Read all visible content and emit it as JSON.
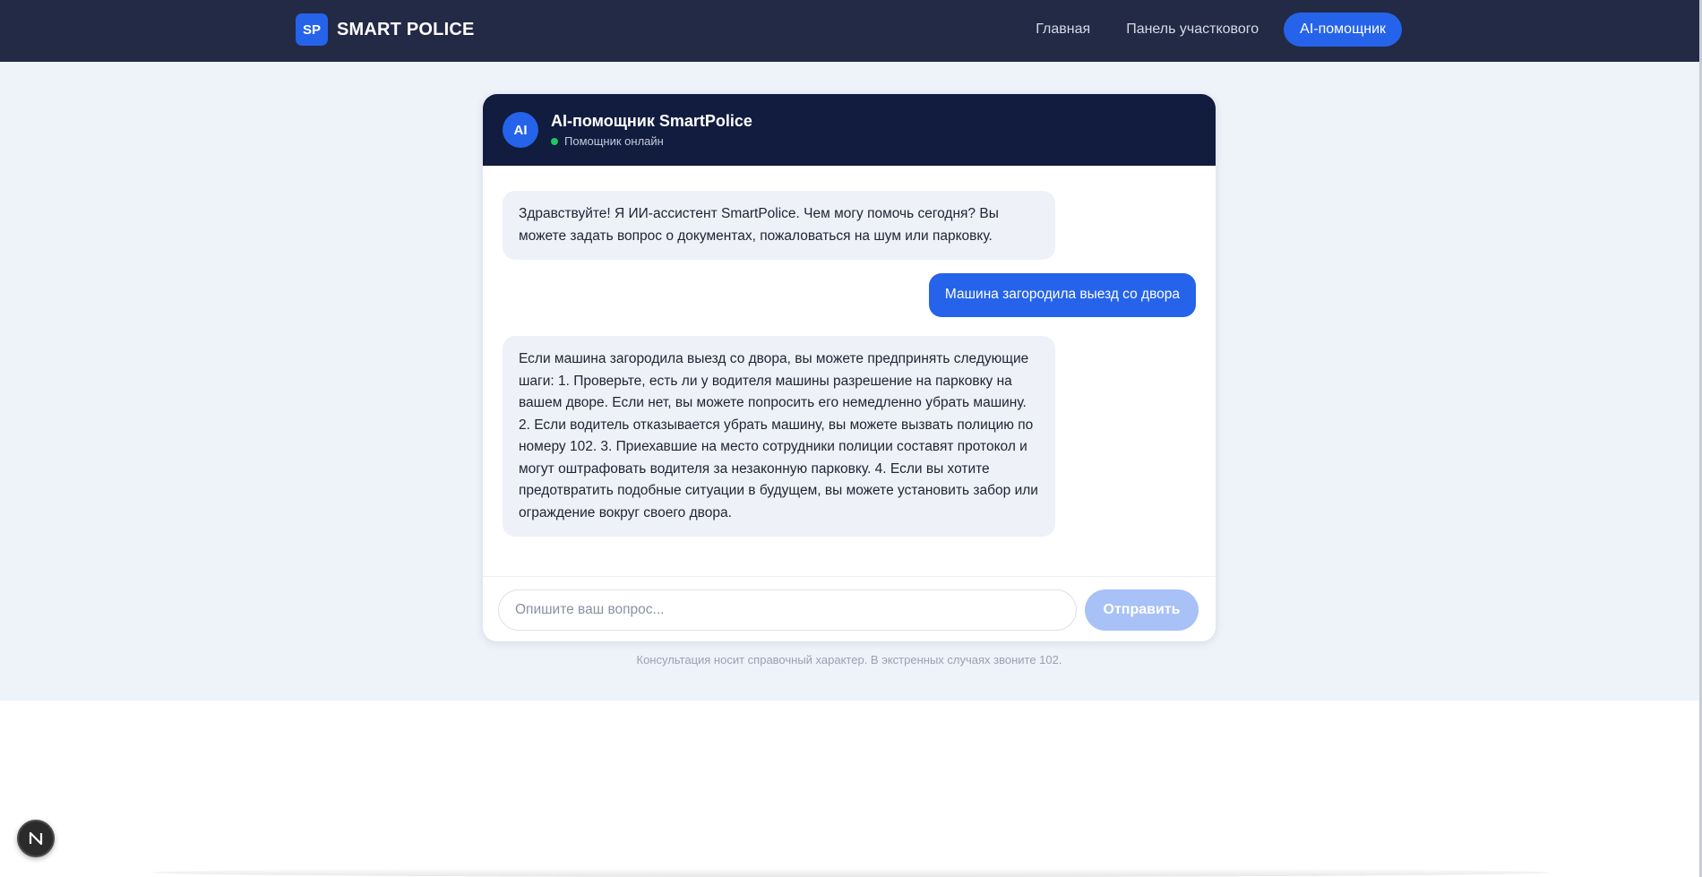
{
  "navbar": {
    "logo_text": "SP",
    "brand_name": "SMART POLICE",
    "links": [
      {
        "label": "Главная",
        "active": false
      },
      {
        "label": "Панель участкового",
        "active": false
      },
      {
        "label": "AI-помощник",
        "active": true
      }
    ]
  },
  "chat": {
    "avatar_text": "AI",
    "title": "AI-помощник SmartPolice",
    "status": "Помощник онлайн",
    "messages": [
      {
        "role": "assistant",
        "text": "Здравствуйте! Я ИИ-ассистент SmartPolice. Чем могу помочь сегодня? Вы можете задать вопрос о документах, пожаловаться на шум или парковку."
      },
      {
        "role": "user",
        "text": "Машина загородила выезд со двора"
      },
      {
        "role": "assistant",
        "text": "Если машина загородила выезд со двора, вы можете предпринять следующие шаги: 1. Проверьте, есть ли у водителя машины разрешение на парковку на вашем дворе. Если нет, вы можете попросить его немедленно убрать машину. 2. Если водитель отказывается убрать машину, вы можете вызвать полицию по номеру 102. 3. Приехавшие на место сотрудники полиции составят протокол и могут оштрафовать водителя за незаконную парковку. 4. Если вы хотите предотвратить подобные ситуации в будущем, вы можете установить забор или ограждение вокруг своего двора."
      }
    ],
    "input_placeholder": "Опишите ваш вопрос...",
    "input_value": "",
    "send_label": "Отправить"
  },
  "footer": {
    "disclaimer": "Консультация носит справочный характер. В экстренных случаях звоните 102."
  },
  "dev_badge": {
    "letter": "N"
  },
  "colors": {
    "nav_bg": "#232a45",
    "chat_header_bg": "#111c3f",
    "accent": "#2563eb",
    "online_dot": "#22c55e",
    "page_bg": "#eef2f9"
  }
}
